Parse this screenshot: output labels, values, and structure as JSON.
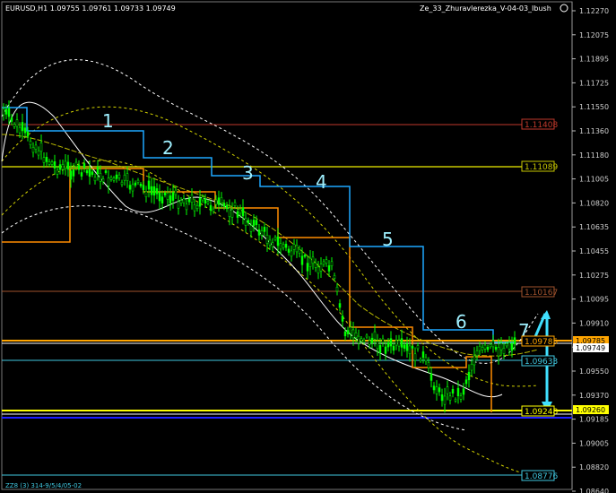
{
  "header": {
    "symbol_info": "EURUSD,H1  1.09755 1.09761 1.09733 1.09749",
    "indicator_name": "Ze_33_Zhuravlerezka_V-04-03_Ibush"
  },
  "footer": {
    "left_text": "ZZ8 (3) 314-9/5/4/05-02"
  },
  "price_axis": {
    "ticks": [
      "1.12270",
      "1.12075",
      "1.11895",
      "1.11725",
      "1.11550",
      "1.11360",
      "1.11180",
      "1.11005",
      "1.10820",
      "1.10635",
      "1.10455",
      "1.10275",
      "1.10095",
      "1.09910",
      "1.09735",
      "1.09550",
      "1.09370",
      "1.09185",
      "1.09005",
      "1.08820",
      "1.08640"
    ],
    "current_price": "1.09749"
  },
  "levels": [
    {
      "value": "1.11408",
      "color": "#c0392b"
    },
    {
      "value": "1.11089",
      "color": "#c8c800"
    },
    {
      "value": "1.10167",
      "color": "#a0522d"
    },
    {
      "value": "1.09785",
      "color": "#ffa500"
    },
    {
      "value": "1.09633",
      "color": "#40c8e0"
    },
    {
      "value": "1.09260",
      "color": "#ffff00"
    },
    {
      "value": "1.09248",
      "color": "#ffffff"
    },
    {
      "value": "1.08776",
      "color": "#40c8e0"
    }
  ],
  "step_labels": [
    "1",
    "2",
    "3",
    "4",
    "5",
    "6",
    "7"
  ],
  "colors": {
    "background": "#000000",
    "candles": "#00ff00",
    "cyan_step": "#1ea8ff",
    "orange_step": "#ff8c00",
    "dashed_envelope": "#d4d400",
    "white_curve": "#ffffff",
    "arrow": "#40e0ff"
  }
}
